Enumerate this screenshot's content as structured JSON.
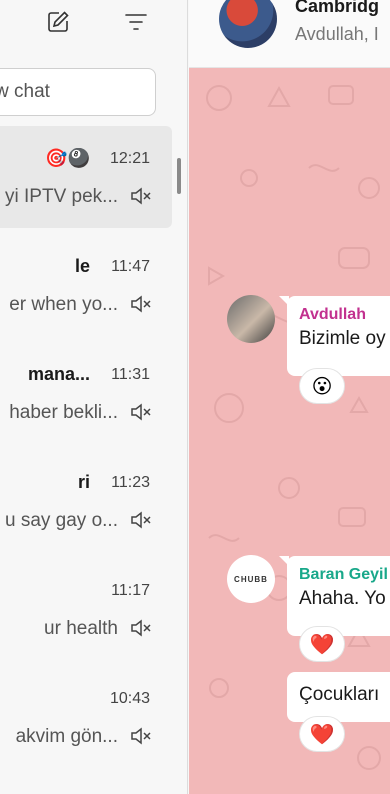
{
  "sidebar": {
    "search_placeholder": "w chat",
    "chats": [
      {
        "title": "🎯🎱",
        "time": "12:21",
        "preview": "yi IPTV pek...",
        "active": true
      },
      {
        "title": "le",
        "time": "11:47",
        "preview": "er when yo...",
        "active": false
      },
      {
        "title": "mana...",
        "time": "11:31",
        "preview": "haber bekli...",
        "active": false
      },
      {
        "title": "ri",
        "time": "11:23",
        "preview": "u say gay o...",
        "active": false
      },
      {
        "title": "",
        "time": "11:17",
        "preview": "ur health",
        "active": false
      },
      {
        "title": "",
        "time": "10:43",
        "preview": "akvim gön...",
        "active": false
      }
    ]
  },
  "chat": {
    "title": "Cambridg",
    "subtitle": "Avdullah, I",
    "messages": [
      {
        "sender": "Avdullah",
        "text": "Bizimle oy",
        "reaction": "😮"
      },
      {
        "sender": "Baran Geyil",
        "avatar_text": "CHUBB",
        "text": "Ahaha. Yo",
        "reaction": "❤️"
      },
      {
        "sender": "",
        "text": "Çocukları",
        "reaction": "❤️"
      }
    ]
  },
  "colors": {
    "chat_bg": "#f2b8b8",
    "sender1": "#c2318f",
    "sender2": "#19a88a"
  }
}
